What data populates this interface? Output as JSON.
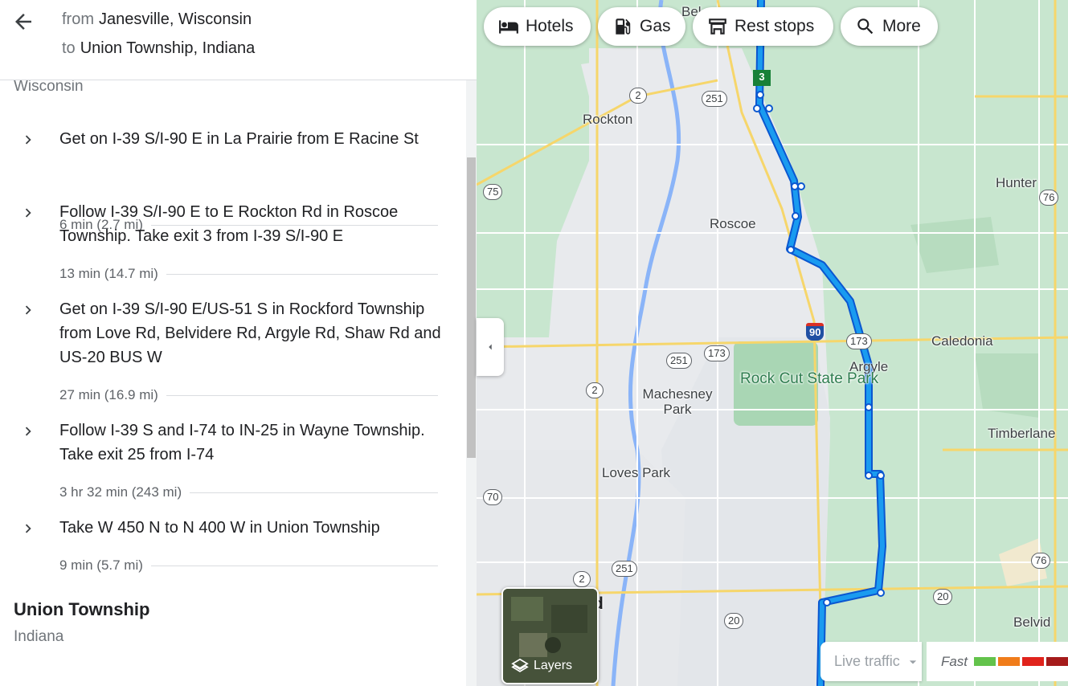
{
  "route": {
    "from_prefix": "from",
    "from_place": "Janesville, Wisconsin",
    "to_prefix": "to",
    "to_place": "Union Township, Indiana"
  },
  "steps": {
    "region_label": "Wisconsin",
    "items": [
      {
        "text": "Get on I-39 S/I-90 E in La Prairie from E Racine St",
        "meta": "6 min (2.7 mi)"
      },
      {
        "text": "Follow I-39 S/I-90 E to E Rockton Rd in Roscoe Township. Take exit 3 from I-39 S/I-90 E",
        "meta": "13 min (14.7 mi)"
      },
      {
        "text": "Get on I-39 S/I-90 E/US-51 S in Rockford Township from Love Rd, Belvidere Rd, Argyle Rd, Shaw Rd and US-20 BUS W",
        "meta": "27 min (16.9 mi)"
      },
      {
        "text": "Follow I-39 S and I-74 to IN-25 in Wayne Township. Take exit 25 from I-74",
        "meta": "3 hr 32 min (243 mi)"
      },
      {
        "text": "Take W 450 N to N 400 W in Union Township",
        "meta": "9 min (5.7 mi)"
      }
    ],
    "destination_title": "Union Township",
    "destination_sub": "Indiana"
  },
  "chips": {
    "hotels": "Hotels",
    "gas": "Gas",
    "rest_stops": "Rest stops",
    "more": "More"
  },
  "map": {
    "labels": {
      "rockton": "Rockton",
      "roscoe": "Roscoe",
      "hunter": "Hunter",
      "caledonia": "Caledonia",
      "argyle": "Argyle",
      "rock_cut": "Rock Cut State Park",
      "machesney": "Machesney Park",
      "timberlane": "Timberlane",
      "loves_park": "Loves Park",
      "belvid": "Belvid",
      "bel": "Bel",
      "rd": "d"
    },
    "shields": [
      "2",
      "251",
      "75",
      "76",
      "173",
      "90",
      "251",
      "173",
      "2",
      "70",
      "2",
      "251",
      "76",
      "20",
      "20",
      "3"
    ],
    "layers_label": "Layers",
    "traffic_select": "Live traffic",
    "traffic_fast": "Fast",
    "traffic_colors": [
      "#63c34b",
      "#f07c1a",
      "#e0231c",
      "#a51b1b"
    ],
    "route_color": "#1a73e8"
  }
}
